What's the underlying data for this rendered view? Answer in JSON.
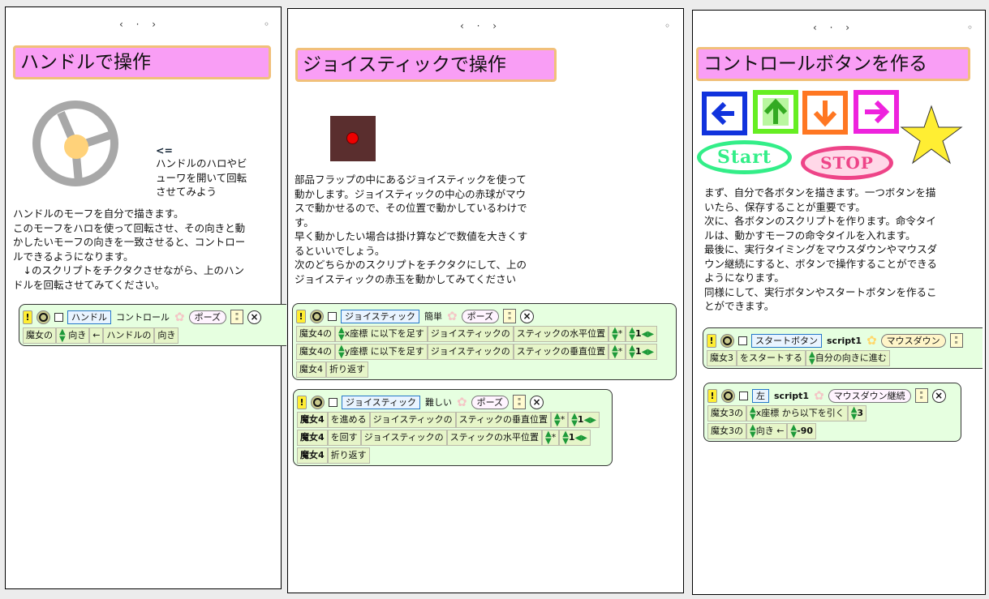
{
  "pages": [
    {
      "nav": "‹ · ›",
      "dot": "◦",
      "title": "ハンドルで操作",
      "arrow_text": "<=",
      "hint_text": "ハンドルのハロやビ\nューワを開いて回転\nさせてみよう",
      "body_text": "ハンドルのモーフを自分で描きます。\nこのモーフをハロを使って回転させ、その向きと動\nかしたいモーフの向きを一致させると、コントロー\nルできるようになります。\n　↓のスクリプトをチクタクさせながら、上のハン\nドルを回転させてみてください。",
      "script": {
        "exclaim": "!",
        "name": "ハンドル",
        "script_name": "コントロール",
        "status": "ポーズ",
        "close": "×",
        "rows": [
          [
            "魔女の",
            "↕",
            "向き",
            "←",
            "ハンドルの",
            "向き"
          ]
        ]
      }
    },
    {
      "nav": "‹ · ›",
      "dot": "◦",
      "title": "ジョイスティックで操作",
      "body_text": "部品フラップの中にあるジョイスティックを使って\n動かします。ジョイスティックの中心の赤球がマウ\nスで動かせるので、その位置で動かしているわけで\nす。\n早く動かしたい場合は掛け算などで数値を大きくす\nるといいでしょう。\n次のどちらかのスクリプトをチクタクにして、上の\nジョイスティックの赤玉を動かしてみてください",
      "script1": {
        "name": "ジョイスティック",
        "script_name": "簡単",
        "status": "ポーズ",
        "rows": [
          [
            "魔女4の",
            "x座標",
            "に以下を足す",
            "ジョイスティックの",
            "スティックの水平位置",
            "*",
            "1"
          ],
          [
            "魔女4の",
            "y座標",
            "に以下を足す",
            "ジョイスティックの",
            "スティックの垂直位置",
            "*",
            "1"
          ],
          [
            "魔女4",
            "折り返す"
          ]
        ]
      },
      "script2": {
        "name": "ジョイスティック",
        "script_name": "難しい",
        "status": "ポーズ",
        "rows": [
          [
            "魔女4",
            "を進める",
            "ジョイスティックの",
            "スティックの垂直位置",
            "*",
            "1"
          ],
          [
            "魔女4",
            "を回す",
            "ジョイスティックの",
            "スティックの水平位置",
            "*",
            "1"
          ],
          [
            "魔女4",
            "折り返す"
          ]
        ]
      }
    },
    {
      "nav": "‹ · ›",
      "dot": "◦",
      "title": "コントロールボタンを作る",
      "start_label": "Start",
      "stop_label": "STOP",
      "body_text": "まず、自分で各ボタンを描きます。一つボタンを描\nいたら、保存することが重要です。\n次に、各ボタンのスクリプトを作ります。命令タイ\nルは、動かすモーフの命令タイルを入れます。\n最後に、実行タイミングをマウスダウンやマウスダ\nウン継続にすると、ボタンで操作することができる\nようになります。\n同様にして、実行ボタンやスタートボタンを作るこ\nとができます。",
      "script1": {
        "name": "スタートボタン",
        "script_name": "script1",
        "status": "マウスダウン",
        "rows": [
          [
            "魔女3",
            "をスタートする",
            "自分の向きに進む"
          ]
        ]
      },
      "script2": {
        "name": "左",
        "script_name": "script1",
        "status": "マウスダウン継続",
        "rows": [
          [
            "魔女3の",
            "x座標",
            "から以下を引く",
            "3"
          ],
          [
            "魔女3の",
            "向き",
            "←",
            "-90"
          ]
        ]
      }
    }
  ],
  "colors": {
    "title_bg": "#f99ef5",
    "title_border": "#f1c07a",
    "script_bg": "#e6ffe0",
    "btn_left": "#1133dd",
    "btn_up": "#66ee22",
    "btn_down": "#ff7722",
    "btn_right": "#ee22dd",
    "star": "#ffee33",
    "start": "#33ee88",
    "stop": "#ee4488"
  }
}
